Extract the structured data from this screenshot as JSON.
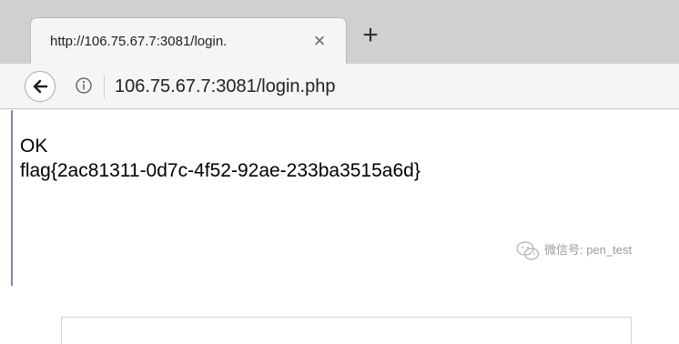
{
  "tab": {
    "title": "http://106.75.67.7:3081/login.",
    "close_glyph": "×",
    "new_tab_glyph": "+"
  },
  "toolbar": {
    "back_icon": "back-arrow-icon",
    "info_icon": "info-icon",
    "url": "106.75.67.7:3081/login.php"
  },
  "page": {
    "line1": "OK",
    "line2": "flag{2ac81311-0d7c-4f52-92ae-233ba3515a6d}"
  },
  "watermark": {
    "icon": "wechat-icon",
    "text": "微信号: pen_test"
  },
  "colors": {
    "tab_strip": "#d0d0d0",
    "toolbar": "#f5f5f5",
    "watermark": "#9a9a9a"
  }
}
